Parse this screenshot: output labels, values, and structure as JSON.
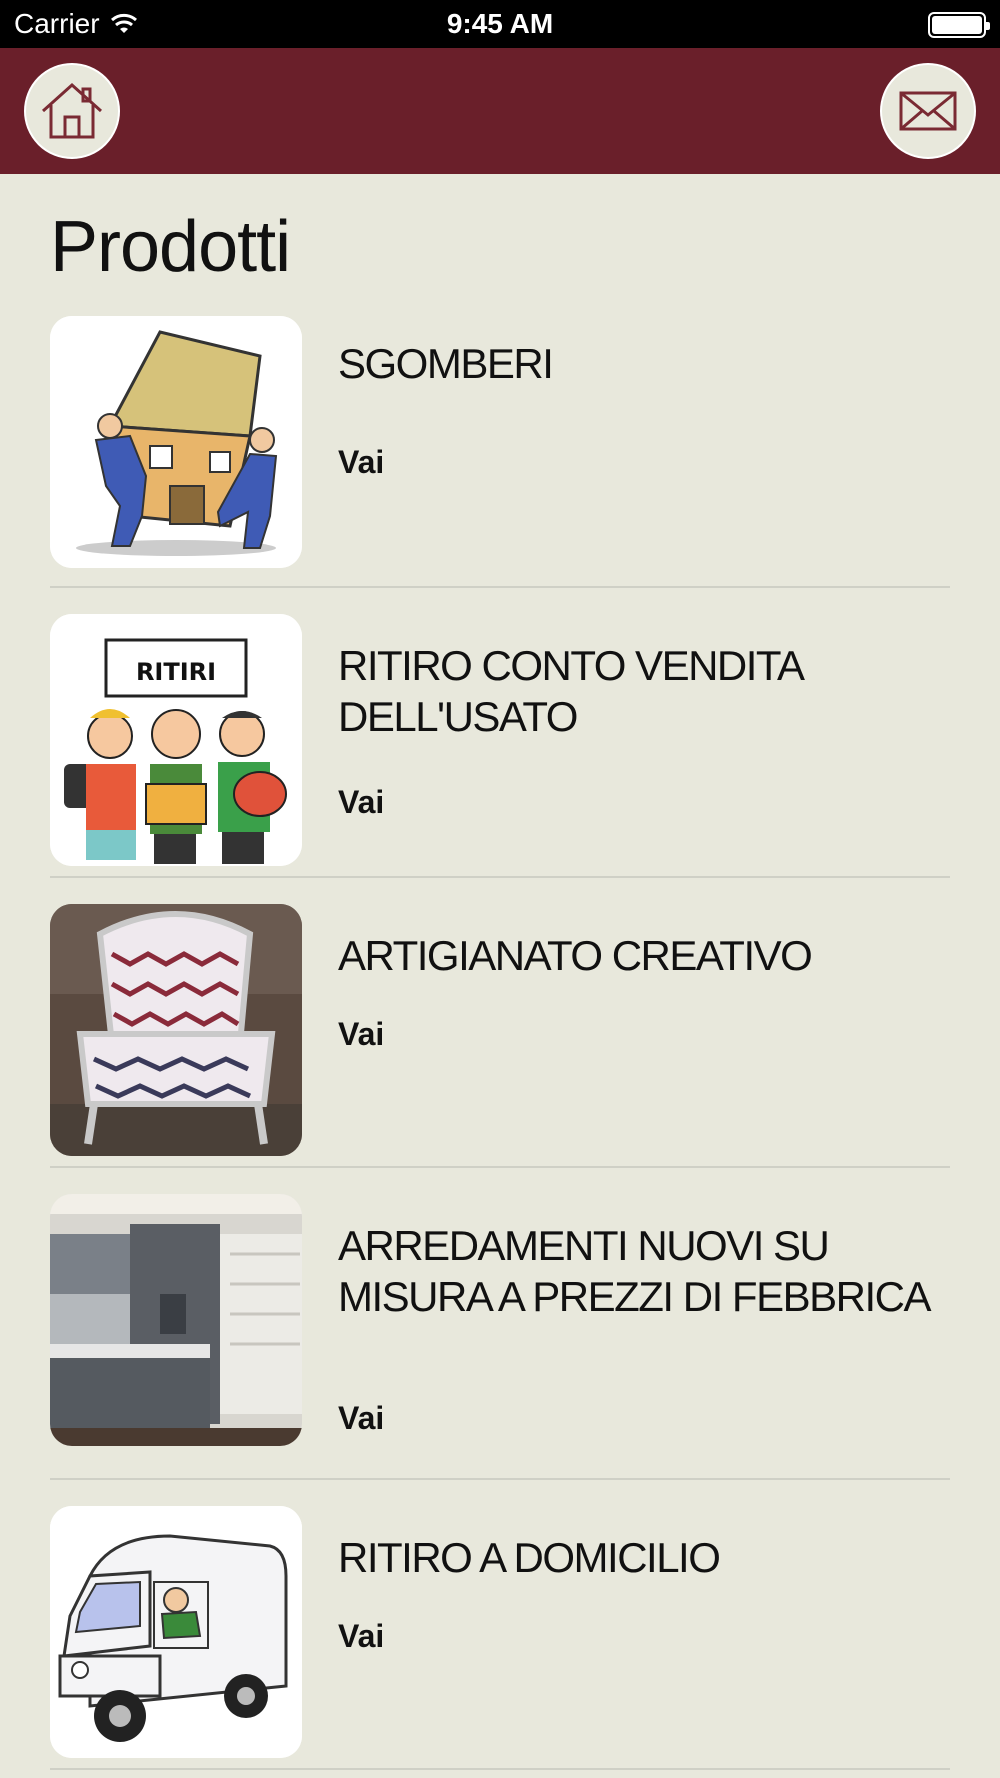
{
  "status_bar": {
    "carrier": "Carrier",
    "time": "9:45 AM"
  },
  "nav": {
    "home_icon": "home-icon",
    "mail_icon": "mail-icon",
    "bar_color": "#6a1f2a"
  },
  "page": {
    "title": "Prodotti"
  },
  "items": [
    {
      "title": "SGOMBERI",
      "link": "Vai",
      "image": "movers-carrying-house"
    },
    {
      "title": "RITIRO CONTO VENDITA DELL'USATO",
      "link": "Vai",
      "image": "ritiri-cartoon",
      "sign": "RITIRI"
    },
    {
      "title": "ARTIGIANATO CREATIVO",
      "link": "Vai",
      "image": "upholstered-armchair"
    },
    {
      "title": "ARREDAMENTI NUOVI SU MISURA A PREZZI DI FEBBRICA",
      "link": "Vai",
      "image": "kitchen-photo"
    },
    {
      "title": "RITIRO A DOMICILIO",
      "link": "Vai",
      "image": "delivery-van"
    }
  ]
}
